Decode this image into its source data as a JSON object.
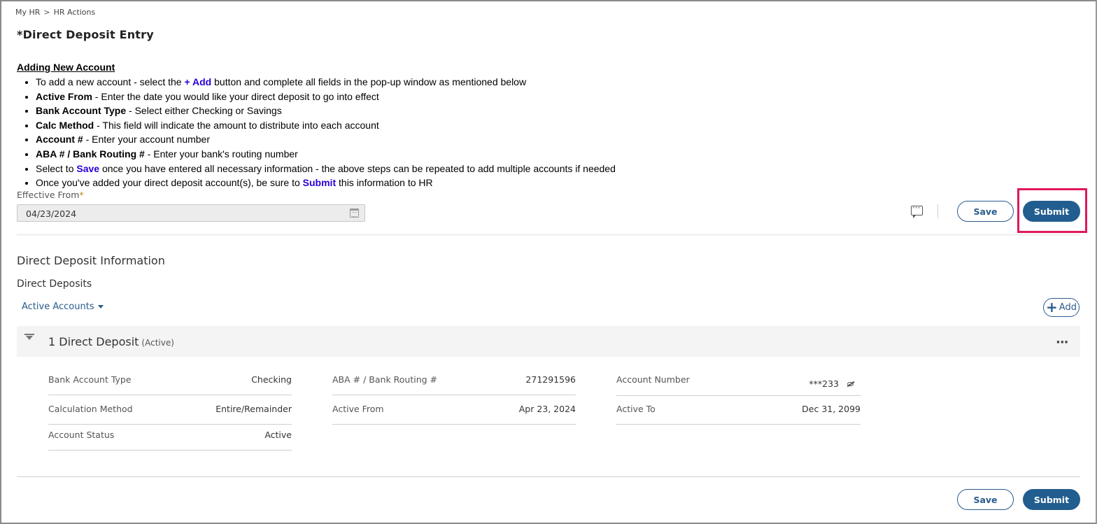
{
  "breadcrumb": {
    "items": [
      "My HR",
      "HR Actions"
    ],
    "separator": ">"
  },
  "page_title": "*Direct Deposit Entry",
  "instructions": {
    "heading": "Adding New Account",
    "items": [
      {
        "parts": [
          {
            "t": "To add a new account - select the ",
            "s": "plain"
          },
          {
            "t": "+ Add",
            "s": "kw"
          },
          {
            "t": " button and complete all fields in the pop-up window as mentioned below",
            "s": "plain"
          }
        ]
      },
      {
        "parts": [
          {
            "t": "Active From",
            "s": "bold"
          },
          {
            "t": " - Enter the date you would like your direct deposit to go into effect",
            "s": "plain"
          }
        ]
      },
      {
        "parts": [
          {
            "t": "Bank Account Type",
            "s": "bold"
          },
          {
            "t": " - Select either Checking or Savings",
            "s": "plain"
          }
        ]
      },
      {
        "parts": [
          {
            "t": "Calc Method",
            "s": "bold"
          },
          {
            "t": " - This field will indicate the amount to distribute into each account",
            "s": "plain"
          }
        ]
      },
      {
        "parts": [
          {
            "t": "Account #",
            "s": "bold"
          },
          {
            "t": " - Enter your account number",
            "s": "plain"
          }
        ]
      },
      {
        "parts": [
          {
            "t": "ABA # / Bank Routing #",
            "s": "bold"
          },
          {
            "t": " - Enter your bank's routing number",
            "s": "plain"
          }
        ]
      },
      {
        "parts": [
          {
            "t": "Select to ",
            "s": "plain"
          },
          {
            "t": "Save",
            "s": "kw"
          },
          {
            "t": " once you have entered all necessary information - the above steps can be repeated to add multiple accounts if needed",
            "s": "plain"
          }
        ]
      },
      {
        "parts": [
          {
            "t": "Once you've added your direct deposit account(s), be sure to ",
            "s": "plain"
          },
          {
            "t": "Submit",
            "s": "kw"
          },
          {
            "t": " this information to HR",
            "s": "plain"
          }
        ]
      }
    ]
  },
  "effective_from": {
    "label": "Effective From",
    "required_mark": "*",
    "value": "04/23/2024"
  },
  "toolbar": {
    "save_label": "Save",
    "submit_label": "Submit",
    "comment_icon": "comment-icon"
  },
  "section": {
    "title": "Direct Deposit Information",
    "subtitle": "Direct Deposits",
    "filter_label": "Active Accounts",
    "add_label": "Add"
  },
  "card": {
    "title": "1 Direct Deposit",
    "status": "(Active)",
    "fields": {
      "bank_account_type": {
        "label": "Bank Account Type",
        "value": "Checking"
      },
      "calculation_method": {
        "label": "Calculation Method",
        "value": "Entire/Remainder"
      },
      "account_status": {
        "label": "Account Status",
        "value": "Active"
      },
      "routing": {
        "label": "ABA # / Bank Routing #",
        "value": "271291596"
      },
      "active_from": {
        "label": "Active From",
        "value": "Apr 23, 2024"
      },
      "account_number": {
        "label": "Account Number",
        "value": "***233"
      },
      "active_to": {
        "label": "Active To",
        "value": "Dec 31, 2099"
      }
    }
  },
  "footer": {
    "save_label": "Save",
    "submit_label": "Submit"
  },
  "colors": {
    "accent": "#225d8f",
    "keyword": "#2a00d6",
    "highlight": "#e0185c"
  }
}
